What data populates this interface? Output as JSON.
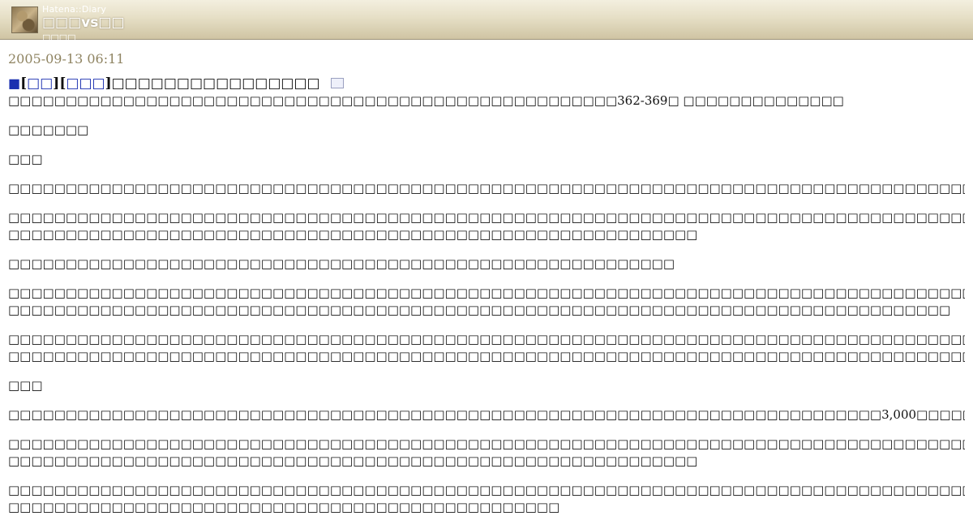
{
  "header": {
    "brand": "Hatena::Diary",
    "title": "□□□vs□□",
    "subtitle": "□□□□"
  },
  "entry": {
    "date": "2005-09-13 06:11",
    "square": "■",
    "cat1": "□□",
    "cat2": "□□□",
    "title": "□□□□□□□□□□□□□□□□"
  },
  "body": {
    "p1": "□□□□□□□□□□□□□□□□□□□□□□□□□□□□□□□□□□□□□□□□□□□□□□□□□□□□□362-369□ □□□□□□□□□□□□□□",
    "p2": "□□□□□□□",
    "h1": "□□□",
    "p3": "□□□□□□□□□□□□□□□□□□□□□□□□□□□□□□□□□□□□□□□□□□□□□□□□□□□□□□□□□□□□□□□□□□□□□□□□□□□□□□□□□□□□□□□□□□□□□□□□□□□□□□□□□□□□",
    "p4a": "□□□□□□□□□□□□□□□□□□□□□□□□□□□□□□□□□□□□□□□□□□□□□□□□□□□□□□□□□□□□□□□□□□□□□□□□□□□□□□□□□□□□□□□□□□□□□□□□□□□□□□□□□□□□□□□□□□",
    "p4b": "□□□□□□□□□□□□□□□□□□□□□□□□□□□□□□□□□□□□□□□□□□□□□□□□□□□□□□□□□□□□",
    "p5": "□□□□□□□□□□□□□□□□□□□□□□□□□□□□□□□□□□□□□□□□□□□□□□□□□□□□□□□□□□",
    "p6a": "□□□□□□□□□□□□□□□□□□□□□□□□□□□□□□□□□□□□□□□□□□□□□□□□□□□□□□□□□□□□□□□□□□□□□□□□□□□□□□□□□□□□□□□□□□□□□□□□□□□□□□□□□□□□□□□□□□",
    "p6b": "□□□□□□□□□□□□□□□□□□□□□□□□□□□□□□□□□□□□□□□□□□□□□□□□□□□□□□□□□□□□□□□□□□□□□□□□□□□□□□□□□□",
    "p7a": "□□□□□□□□□□□□□□□□□□□□□□□□□□□□□□□□□□□□□□□□□□□□□□□□□□□□□□□□□□□□□□□□□□□□□□□□□□□□□□□□□□□□□□□□□□□□□□□□□□□□□□□□□□□□□□□□□□",
    "p7b": "□□□□□□□□□□□□□□□□□□□□□□□□□□□□□□□□□□□□□□□□□□□□□□□□□□□□□□□□□□□□□□□□□□□□□□□□□□□□□□□□□□□□□□□□□□□□□□□□□□□□□□□",
    "h2": "□□□",
    "p8": "□□□□□□□□□□□□□□□□□□□□□□□□□□□□□□□□□□□□□□□□□□□□□□□□□□□□□□□□□□□□□□□□□□□□□□□□□□□□3,000□□□□□□□□□□□□□□□□□□□□□□□□□",
    "p9a": "□□□□□□□□□□□□□□□□□□□□□□□□□□□□□□□□□□□□□□□□□□□□□□□□□□□□□□□□□□□□□□□□□□□□□□□□□□□□□□□□□□□□□□□□□□□□□□□□□□□□□□□□□□□□□□□□□□",
    "p9b": "□□□□□□□□□□□□□□□□□□□□□□□□□□□□□□□□□□□□□□□□□□□□□□□□□□□□□□□□□□□□",
    "p10a": "□□□□□□□□□□□□□□□□□□□□□□□□□□□□□□□□□□□□□□□□□□□□□□□□□□□□□□□□□□□□□□□□□□□□□□□□□□□□□□□□□□□□□□□□□□□□□□□□□□□□□□□□□□□□□□□□□□",
    "p10b": "□□□□□□□□□□□□□□□□□□□□□□□□□□□□□□□□□□□□□□□□□□□□□□□□"
  }
}
